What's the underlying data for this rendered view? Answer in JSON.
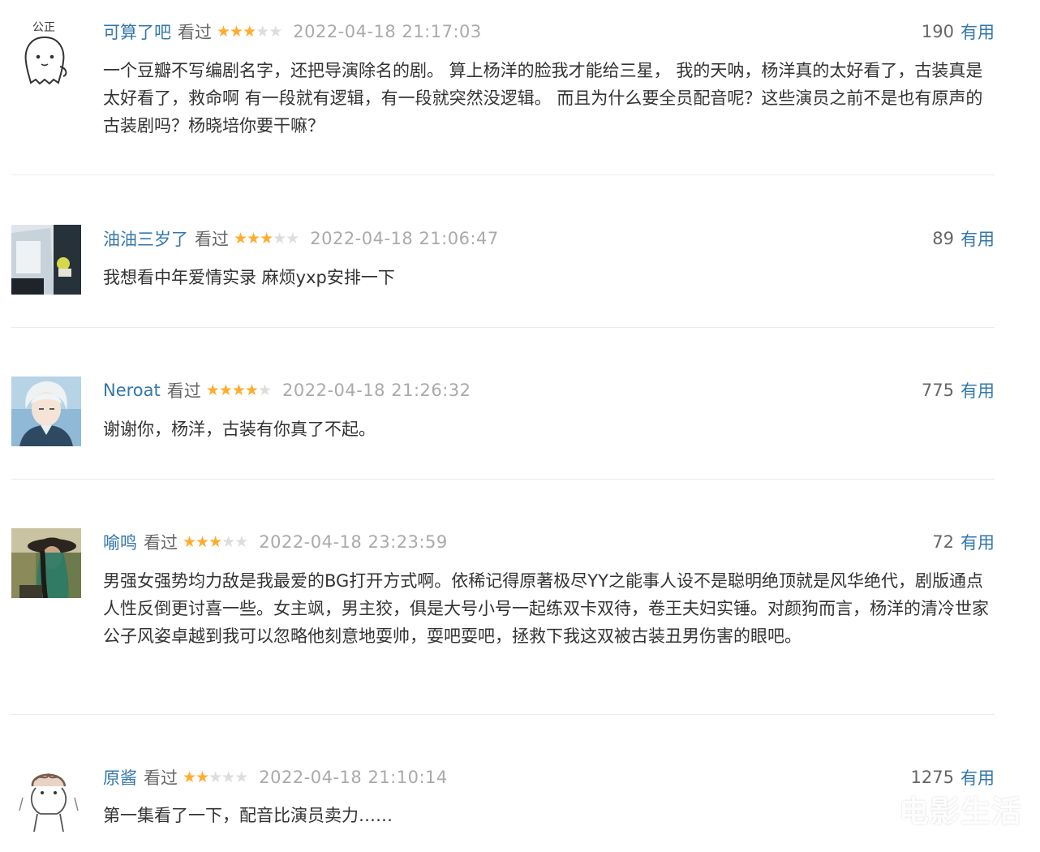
{
  "comments": [
    {
      "username": "可算了吧",
      "status": "看过",
      "rating": 3,
      "time": "2022-04-18 21:17:03",
      "votes": "190",
      "useful_label": "有用",
      "content": "一个豆瓣不写编剧名字，还把导演除名的剧。 算上杨洋的脸我才能给三星， 我的天呐，杨洋真的太好看了，古装真是太好看了，救命啊 有一段就有逻辑，有一段就突然没逻辑。 而且为什么要全员配音呢？这些演员之前不是也有原声的古装剧吗？杨晓培你要干嘛？",
      "avatar_text": "公正",
      "avatar_icon": "cartoon-ghost-icon"
    },
    {
      "username": "油油三岁了",
      "status": "看过",
      "rating": 3,
      "time": "2022-04-18 21:06:47",
      "votes": "89",
      "useful_label": "有用",
      "content": "我想看中年爱情实录 麻烦yxp安排一下",
      "avatar_icon": "photo-avatar-icon"
    },
    {
      "username": "Neroat",
      "status": "看过",
      "rating": 4,
      "time": "2022-04-18 21:26:32",
      "votes": "775",
      "useful_label": "有用",
      "content": "谢谢你，杨洋，古装有你真了不起。",
      "avatar_icon": "anime-character-icon"
    },
    {
      "username": "喻鸣",
      "status": "看过",
      "rating": 3,
      "time": "2022-04-18 23:23:59",
      "votes": "72",
      "useful_label": "有用",
      "content": "男强女强势均力敌是我最爱的BG打开方式啊。依稀记得原著极尽YY之能事人设不是聪明绝顶就是风华绝代，剧版通点人性反倒更讨喜一些。女主飒，男主狡，俱是大号小号一起练双卡双待，卷王夫妇实锤。对颜狗而言，杨洋的清冷世家公子风姿卓越到我可以忽略他刻意地耍帅，耍吧耍吧，拯救下我这双被古装丑男伤害的眼吧。",
      "avatar_icon": "woman-hat-photo-icon"
    },
    {
      "username": "原酱",
      "status": "看过",
      "rating": 2,
      "time": "2022-04-18 21:10:14",
      "votes": "1275",
      "useful_label": "有用",
      "content": "第一集看了一下，配音比演员卖力……",
      "avatar_icon": "sketch-character-icon"
    }
  ],
  "watermark": "电影生活",
  "colors": {
    "username": "#3377aa",
    "star_filled": "#ffac2d",
    "star_empty": "#dddddd",
    "time": "#aaaaaa",
    "text": "#333333"
  }
}
